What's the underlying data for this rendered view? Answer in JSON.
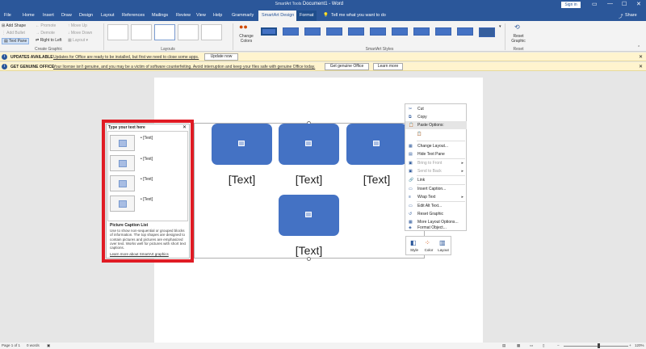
{
  "window": {
    "title": "Document1 - Word",
    "context_tools_label": "SmartArt Tools",
    "sign_in_label": "Sign in",
    "minimize": "—",
    "maximize": "☐",
    "close": "✕"
  },
  "tabs": [
    "File",
    "Home",
    "Insert",
    "Draw",
    "Design",
    "Layout",
    "References",
    "Mailings",
    "Review",
    "View",
    "Help",
    "Grammarly",
    "SmartArt Design",
    "Format"
  ],
  "tell_me": "Tell me what you want to do",
  "share_label": "Share",
  "ribbon": {
    "create_graphic": {
      "add_shape": "Add Shape",
      "add_bullet": "Add Bullet",
      "text_pane": "Text Pane",
      "promote": "Promote",
      "demote": "Demote",
      "right_to_left": "Right to Left",
      "move_up": "Move Up",
      "move_down": "Move Down",
      "layout": "Layout",
      "group_label": "Create Graphic"
    },
    "layouts_label": "Layouts",
    "change_colors": "Change Colors",
    "smartart_styles_label": "SmartArt Styles",
    "reset_graphic": "Reset Graphic",
    "reset_label": "Reset"
  },
  "messages": [
    {
      "heading": "UPDATES AVAILABLE",
      "text": "Updates for Office are ready to be installed, but first we need to close some apps.",
      "button": "Update now"
    },
    {
      "heading": "GET GENUINE OFFICE",
      "text": "Your license isn't genuine, and you may be a victim of software counterfeiting. Avoid interruption and keep your files safe with genuine Office today.",
      "button": "Get genuine Office",
      "button2": "Learn more"
    }
  ],
  "text_pane": {
    "title": "Type your text here",
    "close": "✕",
    "bullets": [
      "[Text]",
      "[Text]",
      "[Text]",
      "[Text]"
    ],
    "desc_title": "Picture Caption List",
    "desc": "Use to show non-sequential or grouped blocks of information. The top shapes are designed to contain pictures and pictures are emphasized over text. Works well for pictures with short text captions.",
    "learn_more": "Learn more about SmartArt graphics"
  },
  "diagram": {
    "captions": [
      "[Text]",
      "[Text]",
      "[Text]",
      "[Text]"
    ]
  },
  "context_menu": [
    {
      "label": "Cut",
      "icon": "✂",
      "enabled": true
    },
    {
      "label": "Copy",
      "icon": "⧉",
      "enabled": true
    },
    {
      "label": "Paste Options:",
      "icon": "📋",
      "enabled": true
    },
    {
      "label": "",
      "icon": "📋",
      "enabled": true
    },
    {
      "label": "Change Layout...",
      "icon": "▦",
      "enabled": true
    },
    {
      "label": "Hide Text Pane",
      "icon": "▤",
      "enabled": true
    },
    {
      "label": "Bring to Front",
      "icon": "▣",
      "enabled": false,
      "submenu": true
    },
    {
      "label": "Send to Back",
      "icon": "▣",
      "enabled": false,
      "submenu": true
    },
    {
      "label": "Link",
      "icon": "🔗",
      "enabled": true
    },
    {
      "label": "Insert Caption...",
      "icon": "▭",
      "enabled": true
    },
    {
      "label": "Wrap Text",
      "icon": "≡",
      "enabled": true,
      "submenu": true
    },
    {
      "label": "Edit Alt Text...",
      "icon": "▭",
      "enabled": true
    },
    {
      "label": "Reset Graphic",
      "icon": "↺",
      "enabled": true
    },
    {
      "label": "More Layout Options...",
      "icon": "▦",
      "enabled": true
    },
    {
      "label": "Format Object...",
      "icon": "◈",
      "enabled": true
    }
  ],
  "mini_toolbar": {
    "style": "Style",
    "color": "Color",
    "layout": "Layout"
  },
  "status": {
    "page": "Page 1 of 1",
    "words": "0 words",
    "zoom": "120%"
  }
}
